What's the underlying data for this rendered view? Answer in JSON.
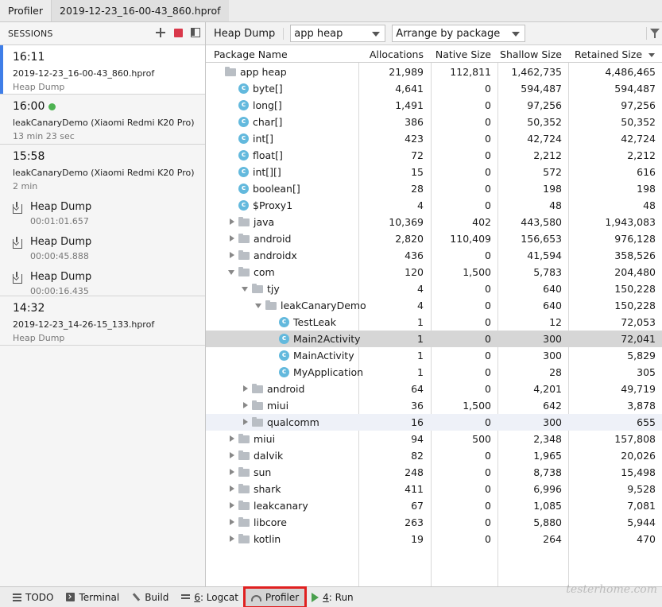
{
  "tabs": {
    "tool": "Profiler",
    "file": "2019-12-23_16-00-43_860.hprof"
  },
  "sessions": {
    "header": "SESSIONS",
    "items": [
      {
        "time": "16:11",
        "name": "2019-12-23_16-00-43_860.hprof",
        "sub": "Heap Dump"
      },
      {
        "time": "16:00",
        "name": "leakCanaryDemo (Xiaomi Redmi K20 Pro)",
        "sub": "13 min 23 sec"
      },
      {
        "time": "15:58",
        "name": "leakCanaryDemo (Xiaomi Redmi K20 Pro)",
        "sub": "2 min"
      },
      {
        "time": "14:32",
        "name": "2019-12-23_14-26-15_133.hprof",
        "sub": "Heap Dump"
      }
    ],
    "artifacts": [
      {
        "title": "Heap Dump",
        "time": "00:01:01.657"
      },
      {
        "title": "Heap Dump",
        "time": "00:00:45.888"
      },
      {
        "title": "Heap Dump",
        "time": "00:00:16.435"
      }
    ]
  },
  "toolbar": {
    "label": "Heap Dump",
    "heap_select": "app heap",
    "arrange_select": "Arrange by package"
  },
  "table": {
    "columns": [
      "Package Name",
      "Allocations",
      "Native Size",
      "Shallow Size",
      "Retained Size"
    ],
    "rows": [
      {
        "name": "app heap",
        "type": "folder",
        "depth": 0,
        "exp": "none",
        "alloc": "21,989",
        "native": "112,811",
        "shallow": "1,462,735",
        "retained": "4,486,465"
      },
      {
        "name": "byte[]",
        "type": "class",
        "depth": 1,
        "exp": "none",
        "alloc": "4,641",
        "native": "0",
        "shallow": "594,487",
        "retained": "594,487"
      },
      {
        "name": "long[]",
        "type": "class",
        "depth": 1,
        "exp": "none",
        "alloc": "1,491",
        "native": "0",
        "shallow": "97,256",
        "retained": "97,256"
      },
      {
        "name": "char[]",
        "type": "class",
        "depth": 1,
        "exp": "none",
        "alloc": "386",
        "native": "0",
        "shallow": "50,352",
        "retained": "50,352"
      },
      {
        "name": "int[]",
        "type": "class",
        "depth": 1,
        "exp": "none",
        "alloc": "423",
        "native": "0",
        "shallow": "42,724",
        "retained": "42,724"
      },
      {
        "name": "float[]",
        "type": "class",
        "depth": 1,
        "exp": "none",
        "alloc": "72",
        "native": "0",
        "shallow": "2,212",
        "retained": "2,212"
      },
      {
        "name": "int[][]",
        "type": "class",
        "depth": 1,
        "exp": "none",
        "alloc": "15",
        "native": "0",
        "shallow": "572",
        "retained": "616"
      },
      {
        "name": "boolean[]",
        "type": "class",
        "depth": 1,
        "exp": "none",
        "alloc": "28",
        "native": "0",
        "shallow": "198",
        "retained": "198"
      },
      {
        "name": "$Proxy1",
        "type": "class",
        "depth": 1,
        "exp": "none",
        "alloc": "4",
        "native": "0",
        "shallow": "48",
        "retained": "48"
      },
      {
        "name": "java",
        "type": "folder",
        "depth": 1,
        "exp": "collapsed",
        "alloc": "10,369",
        "native": "402",
        "shallow": "443,580",
        "retained": "1,943,083"
      },
      {
        "name": "android",
        "type": "folder",
        "depth": 1,
        "exp": "collapsed",
        "alloc": "2,820",
        "native": "110,409",
        "shallow": "156,653",
        "retained": "976,128"
      },
      {
        "name": "androidx",
        "type": "folder",
        "depth": 1,
        "exp": "collapsed",
        "alloc": "436",
        "native": "0",
        "shallow": "41,594",
        "retained": "358,526"
      },
      {
        "name": "com",
        "type": "folder",
        "depth": 1,
        "exp": "expanded",
        "alloc": "120",
        "native": "1,500",
        "shallow": "5,783",
        "retained": "204,480"
      },
      {
        "name": "tjy",
        "type": "folder",
        "depth": 2,
        "exp": "expanded",
        "alloc": "4",
        "native": "0",
        "shallow": "640",
        "retained": "150,228"
      },
      {
        "name": "leakCanaryDemo",
        "type": "folder",
        "depth": 3,
        "exp": "expanded",
        "alloc": "4",
        "native": "0",
        "shallow": "640",
        "retained": "150,228"
      },
      {
        "name": "TestLeak",
        "type": "class",
        "depth": 4,
        "exp": "none",
        "alloc": "1",
        "native": "0",
        "shallow": "12",
        "retained": "72,053"
      },
      {
        "name": "Main2Activity",
        "type": "class",
        "depth": 4,
        "exp": "none",
        "alloc": "1",
        "native": "0",
        "shallow": "300",
        "retained": "72,041",
        "state": "selected"
      },
      {
        "name": "MainActivity",
        "type": "class",
        "depth": 4,
        "exp": "none",
        "alloc": "1",
        "native": "0",
        "shallow": "300",
        "retained": "5,829"
      },
      {
        "name": "MyApplication",
        "type": "class",
        "depth": 4,
        "exp": "none",
        "alloc": "1",
        "native": "0",
        "shallow": "28",
        "retained": "305"
      },
      {
        "name": "android",
        "type": "folder",
        "depth": 2,
        "exp": "collapsed",
        "alloc": "64",
        "native": "0",
        "shallow": "4,201",
        "retained": "49,719"
      },
      {
        "name": "miui",
        "type": "folder",
        "depth": 2,
        "exp": "collapsed",
        "alloc": "36",
        "native": "1,500",
        "shallow": "642",
        "retained": "3,878"
      },
      {
        "name": "qualcomm",
        "type": "folder",
        "depth": 2,
        "exp": "collapsed",
        "alloc": "16",
        "native": "0",
        "shallow": "300",
        "retained": "655",
        "state": "hover"
      },
      {
        "name": "miui",
        "type": "folder",
        "depth": 1,
        "exp": "collapsed",
        "alloc": "94",
        "native": "500",
        "shallow": "2,348",
        "retained": "157,808"
      },
      {
        "name": "dalvik",
        "type": "folder",
        "depth": 1,
        "exp": "collapsed",
        "alloc": "82",
        "native": "0",
        "shallow": "1,965",
        "retained": "20,026"
      },
      {
        "name": "sun",
        "type": "folder",
        "depth": 1,
        "exp": "collapsed",
        "alloc": "248",
        "native": "0",
        "shallow": "8,738",
        "retained": "15,498"
      },
      {
        "name": "shark",
        "type": "folder",
        "depth": 1,
        "exp": "collapsed",
        "alloc": "411",
        "native": "0",
        "shallow": "6,996",
        "retained": "9,528"
      },
      {
        "name": "leakcanary",
        "type": "folder",
        "depth": 1,
        "exp": "collapsed",
        "alloc": "67",
        "native": "0",
        "shallow": "1,085",
        "retained": "7,081"
      },
      {
        "name": "libcore",
        "type": "folder",
        "depth": 1,
        "exp": "collapsed",
        "alloc": "263",
        "native": "0",
        "shallow": "5,880",
        "retained": "5,944"
      },
      {
        "name": "kotlin",
        "type": "folder",
        "depth": 1,
        "exp": "collapsed",
        "alloc": "19",
        "native": "0",
        "shallow": "264",
        "retained": "470"
      }
    ]
  },
  "bottom": {
    "todo": "TODO",
    "terminal": "Terminal",
    "build": "Build",
    "logcat_num": "6",
    "logcat": ": Logcat",
    "profiler": "Profiler",
    "run_num": "4",
    "run": ": Run"
  },
  "watermark": "testerhome.com",
  "colors": {
    "selection": "#3f7ee8",
    "stop": "#d9384a",
    "live": "#4db251",
    "class_icon": "#63b9dd",
    "highlight_box": "#e02020"
  }
}
